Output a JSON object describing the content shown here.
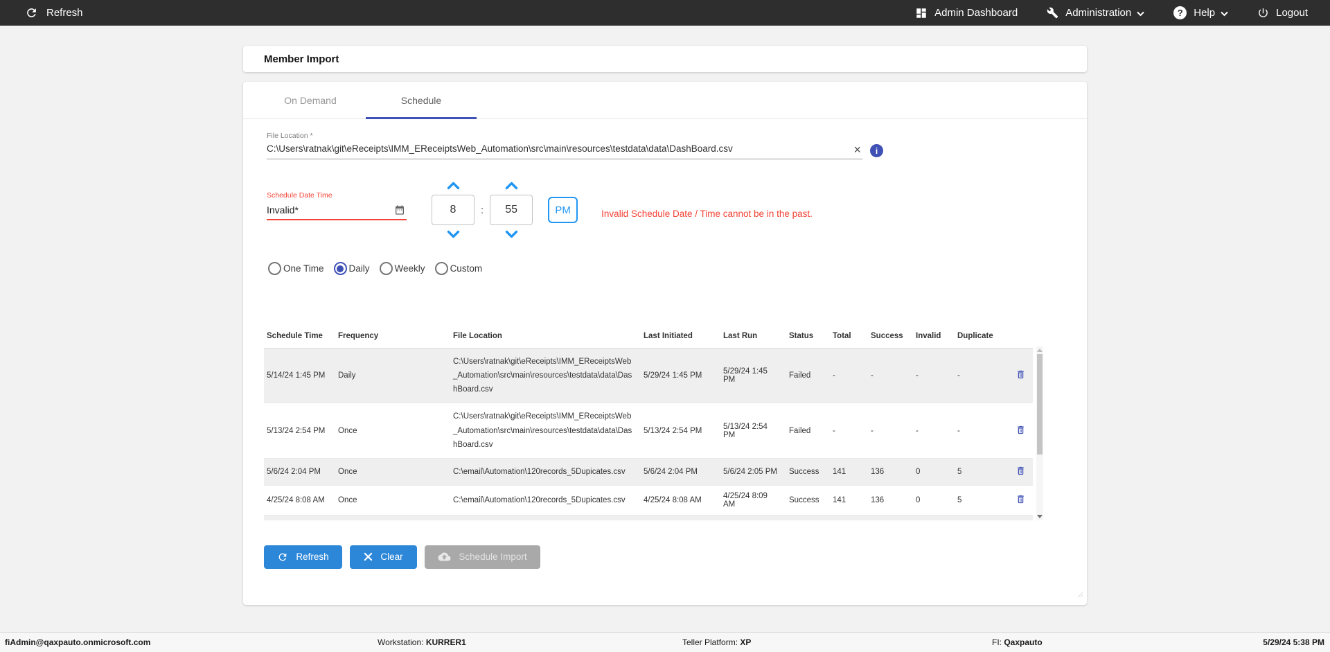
{
  "topbar": {
    "refresh": "Refresh",
    "admin_dashboard": "Admin Dashboard",
    "administration": "Administration",
    "help": "Help",
    "logout": "Logout"
  },
  "page": {
    "title": "Member Import"
  },
  "tabs": [
    {
      "label": "On Demand",
      "active": false
    },
    {
      "label": "Schedule",
      "active": true
    }
  ],
  "file_location": {
    "label": "File Location *",
    "value": "C:\\Users\\ratnak\\git\\eReceipts\\IMM_EReceiptsWeb_Automation\\src\\main\\resources\\testdata\\data\\DashBoard.csv",
    "clear_icon": "×",
    "info_icon": "i"
  },
  "schedule_datetime": {
    "label": "Schedule Date Time",
    "value": "Invalid*",
    "hour": "8",
    "colon": ":",
    "minute": "55",
    "meridiem": "PM",
    "error": "Invalid Schedule Date / Time cannot be in the past."
  },
  "frequency": {
    "options": [
      {
        "label": "One Time",
        "selected": false
      },
      {
        "label": "Daily",
        "selected": true
      },
      {
        "label": "Weekly",
        "selected": false
      },
      {
        "label": "Custom",
        "selected": false
      }
    ]
  },
  "table": {
    "headers": [
      "Schedule Time",
      "Frequency",
      "File Location",
      "Last Initiated",
      "Last Run",
      "Status",
      "Total",
      "Success",
      "Invalid",
      "Duplicate"
    ],
    "rows": [
      {
        "schedule_time": "5/14/24 1:45 PM",
        "frequency": "Daily",
        "file_location": "C:\\Users\\ratnak\\git\\eReceipts\\IMM_EReceiptsWeb_Automation\\src\\main\\resources\\testdata\\data\\DashBoard.csv",
        "last_initiated": "5/29/24 1:45 PM",
        "last_run": "5/29/24 1:45 PM",
        "status": "Failed",
        "total": "-",
        "success": "-",
        "invalid": "-",
        "duplicate": "-"
      },
      {
        "schedule_time": "5/13/24 2:54 PM",
        "frequency": "Once",
        "file_location": "C:\\Users\\ratnak\\git\\eReceipts\\IMM_EReceiptsWeb_Automation\\src\\main\\resources\\testdata\\data\\DashBoard.csv",
        "last_initiated": "5/13/24 2:54 PM",
        "last_run": "5/13/24 2:54 PM",
        "status": "Failed",
        "total": "-",
        "success": "-",
        "invalid": "-",
        "duplicate": "-"
      },
      {
        "schedule_time": "5/6/24 2:04 PM",
        "frequency": "Once",
        "file_location": "C:\\email\\Automation\\120records_5Dupicates.csv",
        "last_initiated": "5/6/24 2:04 PM",
        "last_run": "5/6/24 2:05 PM",
        "status": "Success",
        "total": "141",
        "success": "136",
        "invalid": "0",
        "duplicate": "5"
      },
      {
        "schedule_time": "4/25/24 8:08 AM",
        "frequency": "Once",
        "file_location": "C:\\email\\Automation\\120records_5Dupicates.csv",
        "last_initiated": "4/25/24 8:08 AM",
        "last_run": "4/25/24 8:09 AM",
        "status": "Success",
        "total": "141",
        "success": "136",
        "invalid": "0",
        "duplicate": "5"
      }
    ]
  },
  "actions": {
    "refresh": "Refresh",
    "clear": "Clear",
    "schedule_import": "Schedule Import"
  },
  "footer": {
    "user": "fiAdmin@qaxpauto.onmicrosoft.com",
    "workstation_label": "Workstation:",
    "workstation_value": "KURRER1",
    "teller_label": "Teller Platform:",
    "teller_value": "XP",
    "fi_label": "FI:",
    "fi_value": "Qaxpauto",
    "datetime": "5/29/24 5:38 PM"
  },
  "colors": {
    "topbar_bg": "#2e2e2e",
    "accent_blue": "#2196f3",
    "indigo": "#3f51b5",
    "button_blue": "#2d87d8",
    "disabled_gray": "#a9a9a9",
    "error_red": "#f44336",
    "page_bg": "#f2f2f2"
  }
}
